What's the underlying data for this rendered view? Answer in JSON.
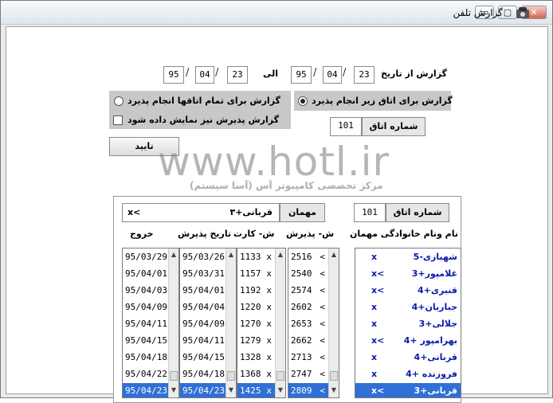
{
  "window": {
    "title": "گزارش تلفن"
  },
  "title_buttons": {
    "minimize": "▭",
    "maximize": "▢",
    "close": "✕"
  },
  "filter": {
    "from_label": "گزارش از تاریخ",
    "to_label": "الی",
    "from_date": {
      "day": "23",
      "month": "04",
      "year": "95"
    },
    "to_date": {
      "day": "23",
      "month": "04",
      "year": "95"
    },
    "separator": "/"
  },
  "options": {
    "all_rooms_label": "گزارش برای تمام اتاقها انجام پذیرد",
    "room_below_label": "گزارش برای اتاق زیر انجام پذیرد",
    "show_checkin_label": "گزارش پذیرش نیز نمایش داده شود",
    "room_number_label": "شماره اتاق",
    "room_number_value": "101",
    "confirm_label": "تایید"
  },
  "watermark": {
    "main": "www.hotl.ir",
    "sub": "مرکز تخصصی کامپیوتر آس (آسا سیستم)"
  },
  "details": {
    "room_label": "شماره اتاق",
    "room_value": "101",
    "guest_label": "مهمان",
    "guest_value": "قربانی+۳",
    "guest_prefix": "x<"
  },
  "columns": {
    "name": "نام ونام خانوادگی مهمان",
    "checkin_no": "ش- پذیرش",
    "card_no": "ش- کارت",
    "checkin_date": "تاریخ پذیرش",
    "checkout": "خروج"
  },
  "rows": [
    {
      "name": "شهبازی-5",
      "name_mark": "x",
      "checkin_no": "2516",
      "card_no": "1133",
      "checkin_date": "95/03/26",
      "checkout": "95/03/29"
    },
    {
      "name": "غلامپور+3",
      "name_mark": "x<",
      "checkin_no": "2540",
      "card_no": "1157",
      "checkin_date": "95/03/31",
      "checkout": "95/04/01"
    },
    {
      "name": "قنبری+4",
      "name_mark": "x<",
      "checkin_no": "2574",
      "card_no": "1192",
      "checkin_date": "95/04/01",
      "checkout": "95/04/03"
    },
    {
      "name": "جباریان+4",
      "name_mark": "x",
      "checkin_no": "2602",
      "card_no": "1220",
      "checkin_date": "95/04/04",
      "checkout": "95/04/09"
    },
    {
      "name": "جلالی+3",
      "name_mark": "x",
      "checkin_no": "2653",
      "card_no": "1270",
      "checkin_date": "95/04/09",
      "checkout": "95/04/11"
    },
    {
      "name": "بهرامپور +4",
      "name_mark": "x<",
      "checkin_no": "2662",
      "card_no": "1279",
      "checkin_date": "95/04/11",
      "checkout": "95/04/15"
    },
    {
      "name": "قربانی+4",
      "name_mark": "x",
      "checkin_no": "2713",
      "card_no": "1328",
      "checkin_date": "95/04/15",
      "checkout": "95/04/18"
    },
    {
      "name": "فروزنده +4",
      "name_mark": "x",
      "checkin_no": "2747",
      "card_no": "1368",
      "checkin_date": "95/04/18",
      "checkout": "95/04/22"
    },
    {
      "name": "قربانی+3",
      "name_mark": "x<",
      "checkin_no": "2809",
      "card_no": "1425",
      "checkin_date": "95/04/23",
      "checkout": "95/04/23"
    }
  ],
  "row_marker": "<",
  "row_x": "x"
}
